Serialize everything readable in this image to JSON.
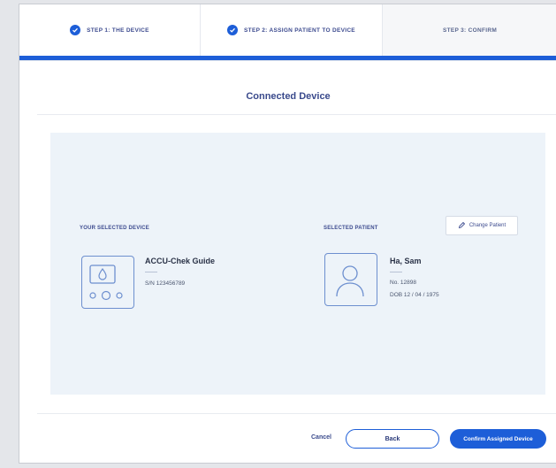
{
  "stepper": {
    "steps": [
      {
        "label": "STEP 1: THE DEVICE",
        "state": "complete"
      },
      {
        "label": "STEP 2: ASSIGN PATIENT TO DEVICE",
        "state": "complete"
      },
      {
        "label": "STEP 3: CONFIRM",
        "state": "current"
      }
    ]
  },
  "page": {
    "title": "Connected Device"
  },
  "device": {
    "section_label": "YOUR SELECTED DEVICE",
    "name": "ACCU-Chek Guide",
    "serial": "S/N 123456789",
    "icon": "glucose-meter-icon"
  },
  "patient": {
    "section_label": "SELECTED PATIENT",
    "change_label": "Change Patient",
    "name": "Ha, Sam",
    "number": "No. 12898",
    "dob": "DOB 12 / 04 / 1975",
    "icon": "person-icon"
  },
  "footer": {
    "cancel_label": "Cancel",
    "back_label": "Back",
    "confirm_label": "Confirm Assigned Device"
  },
  "colors": {
    "accent": "#1d5ed8",
    "panel": "#edf3f9",
    "text_primary": "#3d4b8f"
  }
}
